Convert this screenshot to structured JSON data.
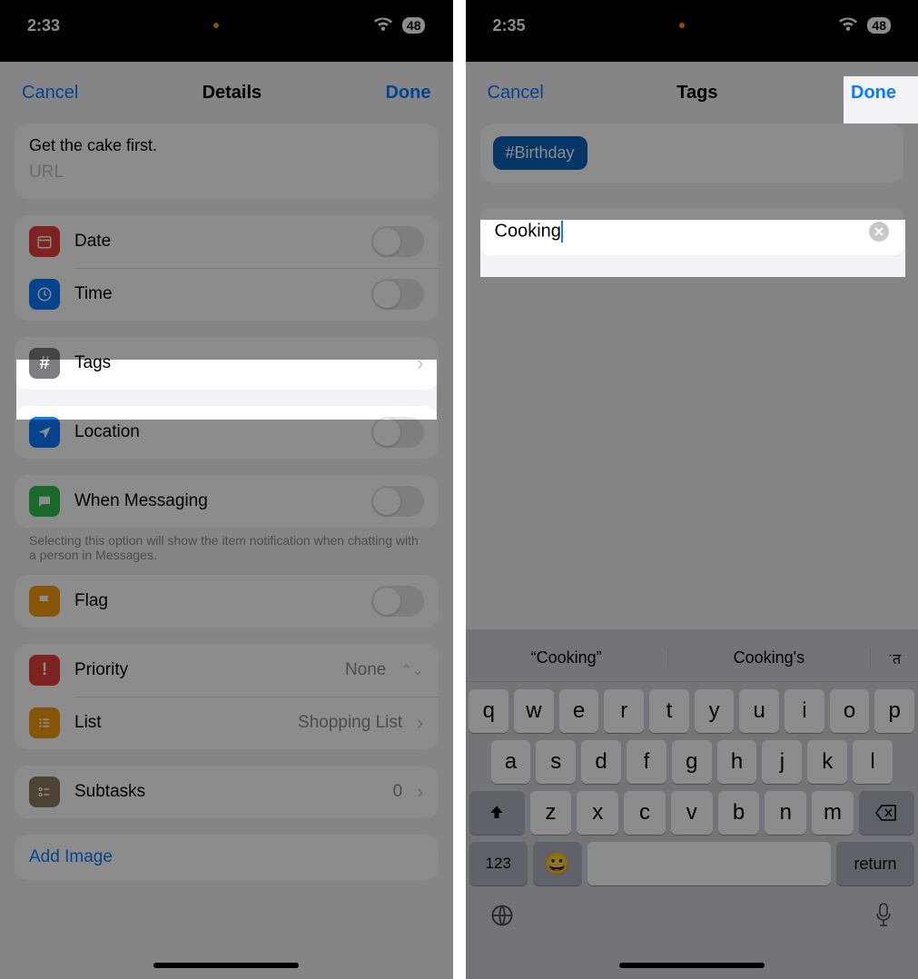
{
  "left": {
    "status": {
      "time": "2:33",
      "battery": "48"
    },
    "nav": {
      "cancel": "Cancel",
      "title": "Details",
      "done": "Done"
    },
    "note": "Get the cake first.",
    "url_placeholder": "URL",
    "rows": {
      "date": "Date",
      "time": "Time",
      "tags": "Tags",
      "location": "Location",
      "messaging": "When Messaging",
      "messaging_footer": "Selecting this option will show the item notification when chatting with a person in Messages.",
      "flag": "Flag",
      "priority": "Priority",
      "priority_value": "None",
      "list": "List",
      "list_value": "Shopping List",
      "subtasks": "Subtasks",
      "subtasks_value": "0"
    },
    "add_image": "Add Image"
  },
  "right": {
    "status": {
      "time": "2:35",
      "battery": "48"
    },
    "nav": {
      "cancel": "Cancel",
      "title": "Tags",
      "done": "Done"
    },
    "existing_tag": "#Birthday",
    "input_value": "Cooking",
    "predictions": {
      "a": "“Cooking”",
      "b": "Cooking's",
      "c": "ॱत"
    },
    "keys": {
      "r1": [
        "q",
        "w",
        "e",
        "r",
        "t",
        "y",
        "u",
        "i",
        "o",
        "p"
      ],
      "r2": [
        "a",
        "s",
        "d",
        "f",
        "g",
        "h",
        "j",
        "k",
        "l"
      ],
      "r3": [
        "z",
        "x",
        "c",
        "v",
        "b",
        "n",
        "m"
      ],
      "num": "123",
      "ret": "return"
    }
  }
}
